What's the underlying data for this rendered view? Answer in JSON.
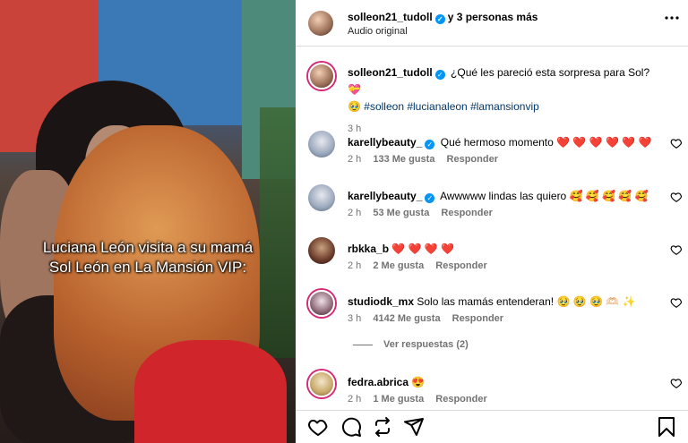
{
  "video": {
    "caption_line1": "Luciana León visita a su mamá",
    "caption_line2": "Sol León en La Mansión VIP:"
  },
  "header": {
    "username": "solleon21_tudoll",
    "collaborators": "y 3 personas más",
    "subtitle": "Audio original",
    "more_icon": "more-horizontal-icon"
  },
  "post_caption": {
    "username": "solleon21_tudoll",
    "text": "¿Qué les pareció esta sorpresa para Sol? 💝",
    "emoji_line": "🥹",
    "hashtags": [
      "#solleon",
      "#lucianaleon",
      "#lamansionvip"
    ],
    "time": "3 h"
  },
  "comments": [
    {
      "username": "karellybeauty_",
      "verified": true,
      "text": "Qué hermoso momento ❤️ ❤️ ❤️ ❤️ ❤️ ❤️",
      "time": "2 h",
      "likes": "133 Me gusta",
      "reply": "Responder"
    },
    {
      "username": "karellybeauty_",
      "verified": true,
      "text": "Awwwww lindas las quiero 🥰 🥰 🥰 🥰 🥰",
      "time": "2 h",
      "likes": "53 Me gusta",
      "reply": "Responder"
    },
    {
      "username": "rbkka_b",
      "verified": false,
      "text": "❤️ ❤️ ❤️ ❤️",
      "time": "2 h",
      "likes": "2 Me gusta",
      "reply": "Responder"
    },
    {
      "username": "studiodk_mx",
      "verified": false,
      "text": "Solo las mamás entenderan! 🥹 🥹 🥹 🫶🏻 ✨",
      "time": "3 h",
      "likes": "4142 Me gusta",
      "reply": "Responder"
    },
    {
      "username": "fedra.abrica",
      "verified": false,
      "text": "😍",
      "time": "2 h",
      "likes": "1 Me gusta",
      "reply": "Responder"
    }
  ],
  "view_replies": "Ver respuestas (2)",
  "actions": [
    "heart-icon",
    "comment-icon",
    "repost-icon",
    "share-icon",
    "bookmark-icon"
  ]
}
